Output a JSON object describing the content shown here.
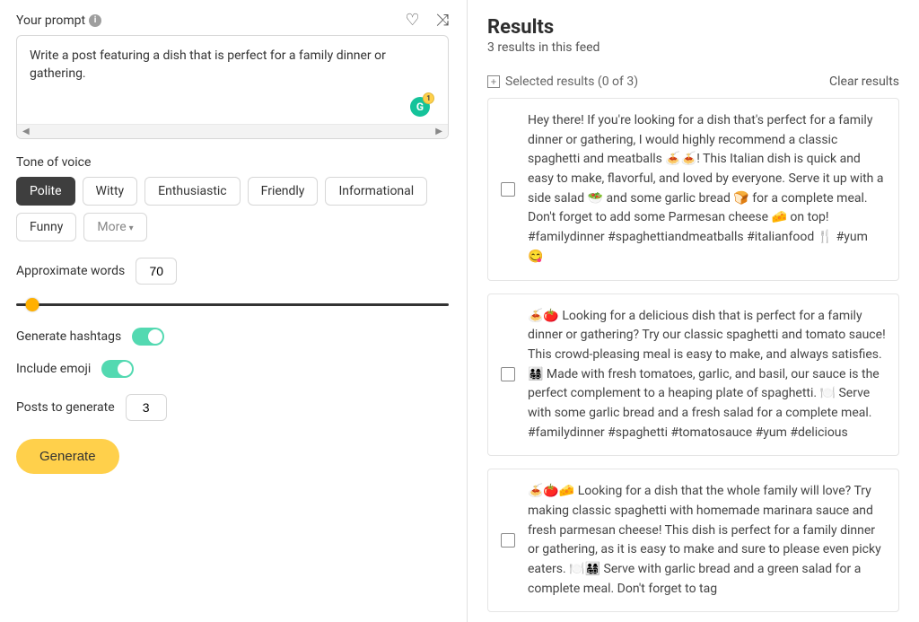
{
  "prompt": {
    "label": "Your prompt",
    "text": "Write a post featuring a dish that is perfect for a family dinner or gathering.",
    "grammarly_badge": "1"
  },
  "tone": {
    "label": "Tone of voice",
    "items": [
      "Polite",
      "Witty",
      "Enthusiastic",
      "Friendly",
      "Informational",
      "Funny",
      "More"
    ],
    "active": "Polite"
  },
  "words": {
    "label": "Approximate words",
    "value": "70"
  },
  "hashtags": {
    "label": "Generate hashtags",
    "on": true
  },
  "emoji": {
    "label": "Include emoji",
    "on": true
  },
  "posts": {
    "label": "Posts to generate",
    "value": "3"
  },
  "generate_label": "Generate",
  "results": {
    "title": "Results",
    "subtitle": "3 results in this feed",
    "selected_label": "Selected results (0 of 3)",
    "clear_label": "Clear results",
    "items": [
      "Hey there! If you're looking for a dish that's perfect for a family dinner or gathering, I would highly recommend a classic spaghetti and meatballs 🍝🍝! This Italian dish is quick and easy to make, flavorful, and loved by everyone. Serve it up with a side salad 🥗 and some garlic bread 🍞 for a complete meal. Don't forget to add some Parmesan cheese 🧀 on top! #familydinner #spaghettiandmeatballs #italianfood 🍴 #yum 😋",
      "🍝🍅 Looking for a delicious dish that is perfect for a family dinner or gathering? Try our classic spaghetti and tomato sauce! This crowd-pleasing meal is easy to make, and always satisfies. 👨‍👩‍👧‍👦 Made with fresh tomatoes, garlic, and basil, our sauce is the perfect complement to a heaping plate of spaghetti. 🍽️ Serve with some garlic bread and a fresh salad for a complete meal. #familydinner #spaghetti #tomatosauce #yum #delicious",
      "🍝🍅🧀 Looking for a dish that the whole family will love? Try making classic spaghetti with homemade marinara sauce and fresh parmesan cheese! This dish is perfect for a family dinner or gathering, as it is easy to make and sure to please even picky eaters. 🍽️👨‍👩‍👧‍👦 Serve with garlic bread and a green salad for a complete meal. Don't forget to tag"
    ]
  }
}
